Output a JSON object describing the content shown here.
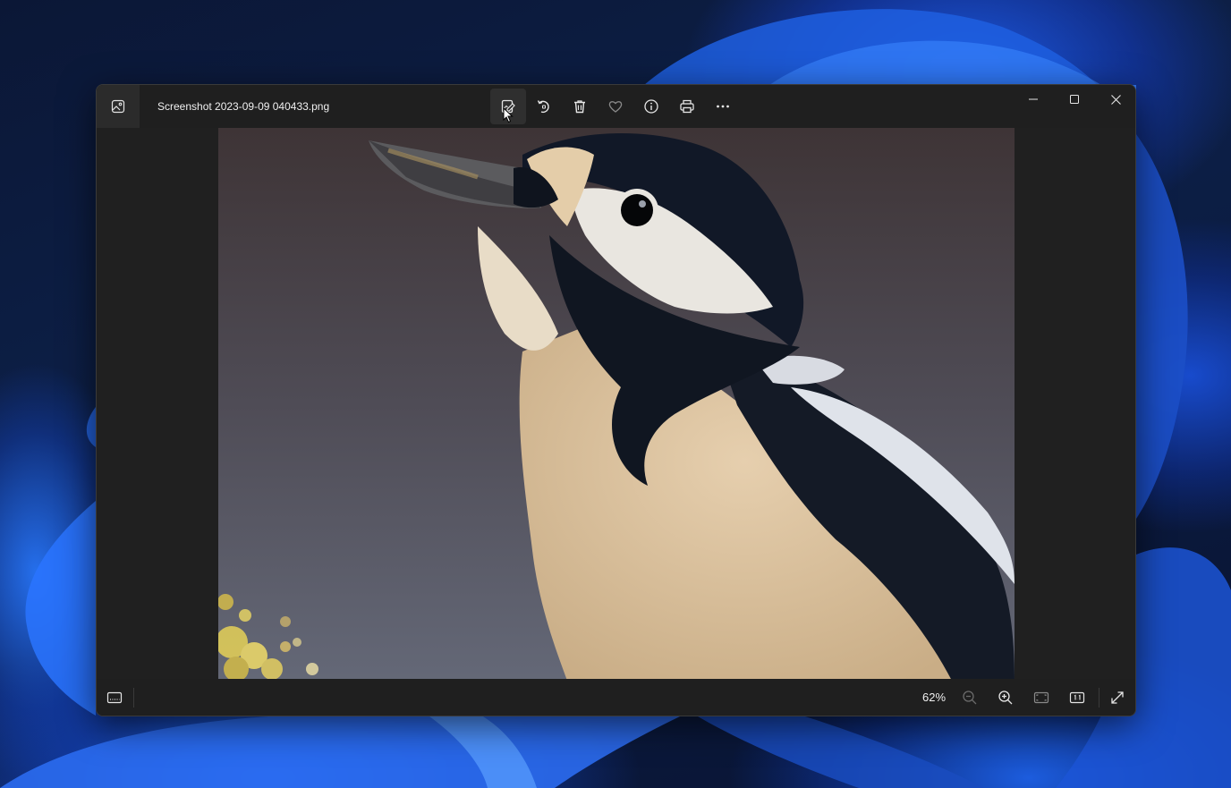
{
  "window": {
    "title": "Screenshot 2023-09-09 040433.png"
  },
  "toolbar": {
    "items": [
      {
        "name": "edit-image",
        "icon": "edit-image-icon",
        "active": true
      },
      {
        "name": "rotate",
        "icon": "rotate-icon"
      },
      {
        "name": "delete",
        "icon": "trash-icon"
      },
      {
        "name": "favorite",
        "icon": "heart-icon"
      },
      {
        "name": "file-info",
        "icon": "info-icon"
      },
      {
        "name": "print",
        "icon": "printer-icon"
      },
      {
        "name": "more",
        "icon": "more-icon"
      }
    ]
  },
  "window_controls": [
    "minimize-icon",
    "maximize-icon",
    "close-icon"
  ],
  "bottombar": {
    "zoom_level": "62%",
    "zoom_out_enabled": false
  },
  "colors": {
    "window_bg": "#202020",
    "titlebar_bg": "#1f1f1f",
    "icon": "#e6e6e6",
    "icon_disabled": "#6a6a6a"
  }
}
